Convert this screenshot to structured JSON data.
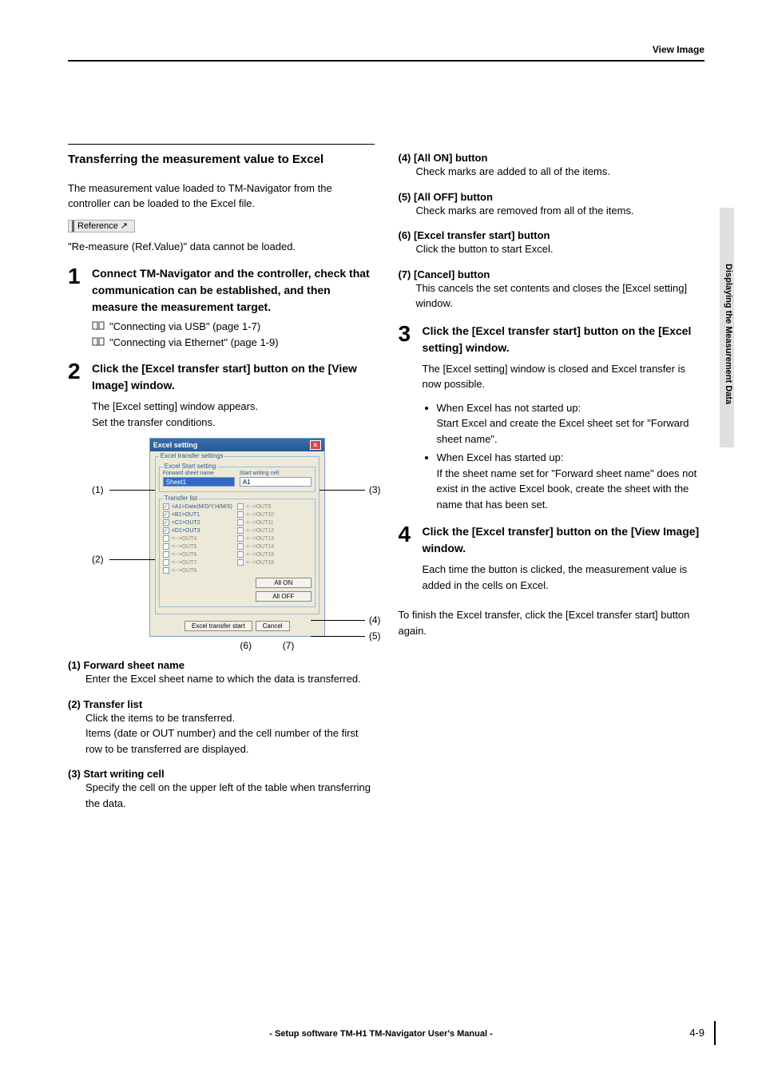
{
  "header": {
    "link": "View Image"
  },
  "side_label": "Displaying the Measurement Data",
  "left": {
    "section_title": "Transferring the measurement value to Excel",
    "intro": "The measurement value loaded to TM-Navigator from the controller can be loaded to the Excel file.",
    "reference_label": "Reference",
    "reference_note": "\"Re-measure (Ref.Value)\" data cannot be loaded.",
    "step1": {
      "num": "1",
      "title": "Connect TM-Navigator and the controller, check that communication can be established, and then measure the measurement target.",
      "links": [
        "\"Connecting via USB\" (page 1-7)",
        "\"Connecting via Ethernet\" (page 1-9)"
      ]
    },
    "step2": {
      "num": "2",
      "title": "Click the [Excel transfer start] button on the [View Image] window.",
      "body": [
        "The [Excel setting] window appears.",
        "Set the transfer conditions."
      ]
    },
    "callouts": {
      "c1": "(1)",
      "c2": "(2)",
      "c3": "(3)",
      "c4": "(4)",
      "c5": "(5)",
      "c6": "(6)",
      "c7": "(7)"
    },
    "dialog": {
      "title": "Excel setting",
      "group1": "Excel transfer settings",
      "group2": "Excel Start setting",
      "fwd_label": "Forward sheet name",
      "fwd_value": "Sheet1",
      "start_label": "Start writing cell",
      "start_value": "A1",
      "tlist": "Transfer list",
      "items_on": [
        "<A1>Date(M/D/Y,H/M/S)",
        "<B1>OUT1",
        "<C1>OUT2",
        "<D1>OUT3"
      ],
      "items_off_left": [
        "<-->OUT4",
        "<-->OUT5",
        "<-->OUT6",
        "<-->OUT7",
        "<-->OUT8"
      ],
      "items_off_right": [
        "<-->OUT9",
        "<-->OUT10",
        "<-->OUT11",
        "<-->OUT12",
        "<-->OUT13",
        "<-->OUT14",
        "<-->OUT15",
        "<-->OUT16"
      ],
      "btn_allon": "All ON",
      "btn_alloff": "All OFF",
      "btn_start": "Excel transfer start",
      "btn_cancel": "Cancel"
    },
    "defs": [
      {
        "label": "(1) Forward sheet name",
        "desc": "Enter the Excel sheet name to which the data is transferred."
      },
      {
        "label": "(2) Transfer list",
        "desc": "Click the items to be transferred.\nItems (date or OUT number) and the cell number of the first row to be transferred are displayed."
      },
      {
        "label": "(3) Start writing cell",
        "desc": "Specify the cell on the upper left of the table when transferring the data."
      }
    ]
  },
  "right": {
    "defs": [
      {
        "label": "(4) [All ON] button",
        "desc": "Check marks are added to all of the items."
      },
      {
        "label": "(5) [All OFF] button",
        "desc": "Check marks are removed from all of the items."
      },
      {
        "label": "(6) [Excel transfer start] button",
        "desc": "Click the button to start Excel."
      },
      {
        "label": "(7) [Cancel] button",
        "desc": "This cancels the set contents and closes the [Excel setting] window."
      }
    ],
    "step3": {
      "num": "3",
      "title": "Click the [Excel transfer start] button on the [Excel setting] window.",
      "body": "The [Excel setting] window is closed and Excel transfer is now possible.",
      "bullets": [
        "When Excel has not started up:\nStart Excel and create the Excel sheet set for \"Forward sheet name\".",
        "When Excel has started up:\nIf the sheet name set for \"Forward sheet name\" does not exist in the active Excel book, create the sheet with the name that has been set."
      ]
    },
    "step4": {
      "num": "4",
      "title": "Click the [Excel transfer] button on the [View Image] window.",
      "body": "Each time the button is clicked, the measurement value is added in the cells on Excel."
    },
    "closing": "To finish the Excel transfer, click the [Excel transfer start] button again."
  },
  "footer": "- Setup software TM-H1 TM-Navigator User's Manual -",
  "page_num": "4-9"
}
